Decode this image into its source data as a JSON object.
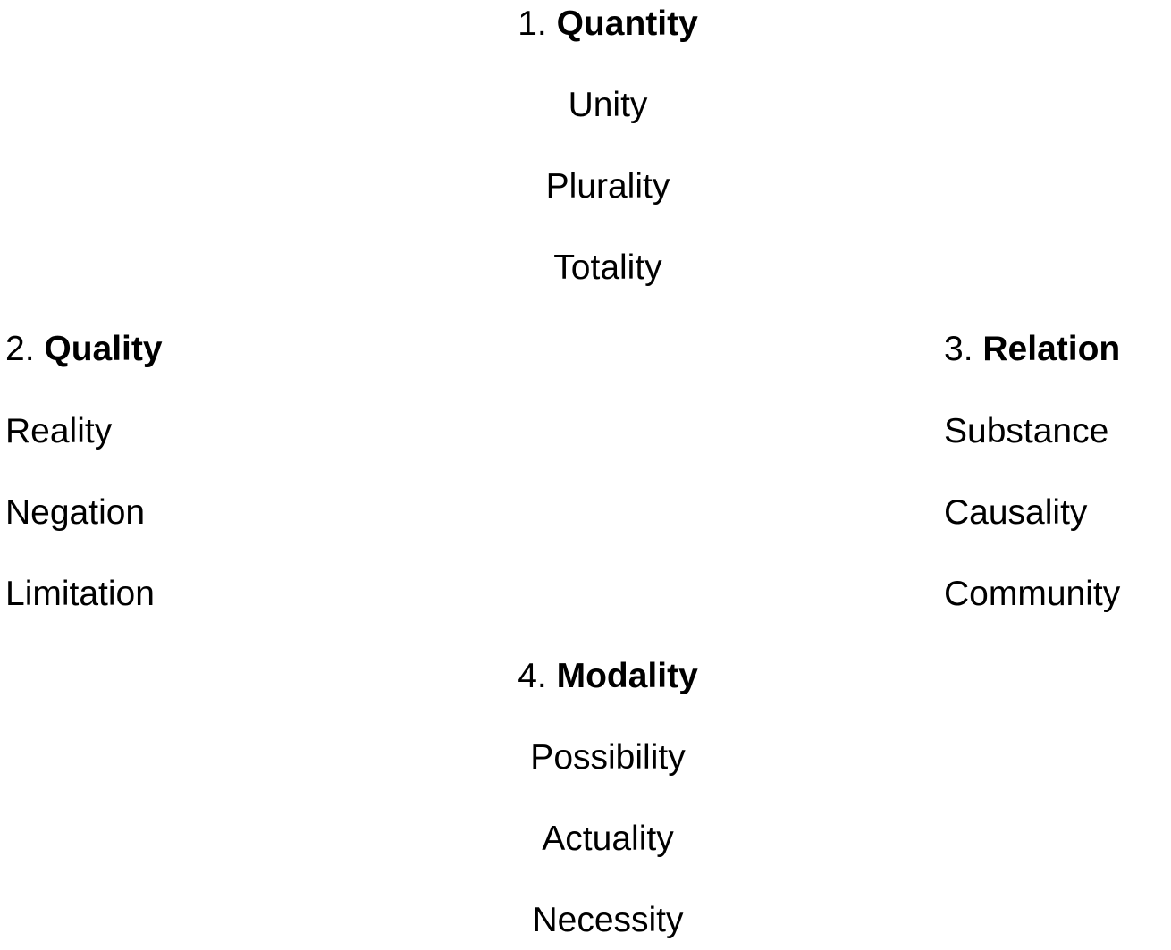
{
  "groups": [
    {
      "number": "1.",
      "title": "Quantity",
      "items": [
        "Unity",
        "Plurality",
        "Totality"
      ]
    },
    {
      "number": "2.",
      "title": "Quality",
      "items": [
        "Reality",
        "Negation",
        "Limitation"
      ]
    },
    {
      "number": "3.",
      "title": "Relation",
      "items": [
        "Substance",
        "Causality",
        "Community"
      ]
    },
    {
      "number": "4.",
      "title": "Modality",
      "items": [
        "Possibility",
        "Actuality",
        "Necessity"
      ]
    }
  ]
}
